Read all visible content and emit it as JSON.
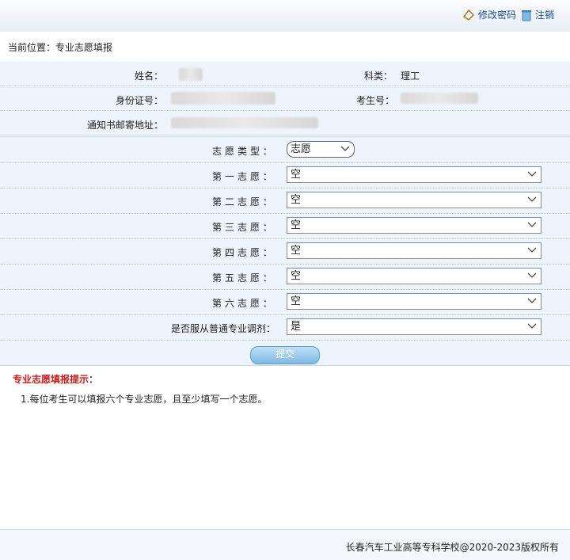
{
  "header": {
    "change_password": "修改密码",
    "logout": "注销"
  },
  "breadcrumb": "当前位置：专业志愿填报",
  "student_info": {
    "name_label": "姓名：",
    "subject_label": "科类：",
    "subject_value": "理工",
    "id_label": "身份证号：",
    "exam_no_label": "考生号：",
    "address_label": "通知书邮寄地址："
  },
  "form": {
    "type_label": "志愿类型：",
    "type_value": "志愿",
    "choices": [
      {
        "label": "第一志愿：",
        "value": "空"
      },
      {
        "label": "第二志愿：",
        "value": "空"
      },
      {
        "label": "第三志愿：",
        "value": "空"
      },
      {
        "label": "第四志愿：",
        "value": "空"
      },
      {
        "label": "第五志愿：",
        "value": "空"
      },
      {
        "label": "第六志愿：",
        "value": "空"
      }
    ],
    "adjust_label": "是否服从普通专业调剂：",
    "adjust_value": "是",
    "submit_label": "提交"
  },
  "tips": {
    "title": "专业志愿填报提示：",
    "items": [
      "1.每位考生可以填报六个专业志愿，且至少填写一个志愿。"
    ]
  },
  "footer": {
    "copyright": "长春汽车工业高等专科学校@2020-2023版权所有"
  },
  "colors": {
    "accent": "#1f4f8f",
    "tip_red": "#c81d1d",
    "panel_bg": "#eef4fb"
  }
}
